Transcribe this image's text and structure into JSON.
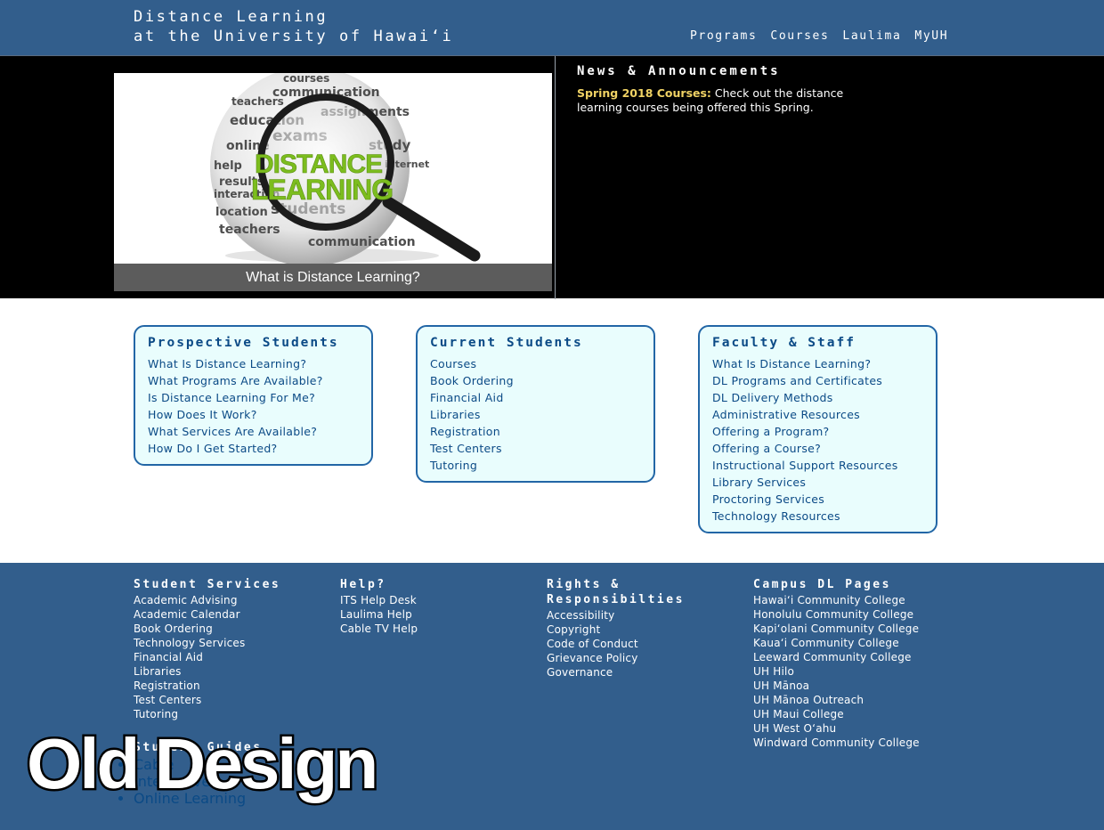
{
  "header": {
    "title_line1": "Distance Learning",
    "title_line2": "at the University of Hawaiʻi",
    "nav": [
      "Programs",
      "Courses",
      "Laulima",
      "MyUH"
    ],
    "bg_color": "#325e8c"
  },
  "hero": {
    "image_caption": "What is Distance Learning?",
    "image_words": {
      "center_line1": "DISTANCE",
      "center_line2": "LEARNING",
      "ring": [
        "courses",
        "communication",
        "teachers",
        "assignments",
        "education",
        "online",
        "exams",
        "study",
        "help",
        "results",
        "students",
        "location",
        "interaction",
        "internet",
        "teachers",
        "communication"
      ]
    },
    "news_title": "News & Announcements",
    "news_highlight": "Spring 2018 Courses:",
    "news_text": " Check out the distance learning courses being offered this Spring."
  },
  "panels": {
    "prospective": {
      "title": "Prospective Students",
      "links": [
        "What Is Distance Learning?",
        "What Programs Are Available?",
        "Is Distance Learning For Me?",
        "How Does It Work?",
        "What Services Are Available?",
        "How Do I Get Started?"
      ]
    },
    "current": {
      "title": "Current Students",
      "links": [
        "Courses",
        "Book Ordering",
        "Financial Aid",
        "Libraries",
        "Registration",
        "Test Centers",
        "Tutoring"
      ]
    },
    "faculty": {
      "title": "Faculty & Staff",
      "links": [
        "What Is Distance Learning?",
        "DL Programs and Certificates",
        "DL Delivery Methods",
        "Administrative Resources",
        "Offering a Program?",
        "Offering a Course?",
        "Instructional Support Resources",
        "Library Services",
        "Proctoring Services",
        "Technology Resources"
      ]
    }
  },
  "footer": {
    "student_services": {
      "title": "Student Services",
      "links": [
        "Academic Advising",
        "Academic Calendar",
        "Book Ordering",
        "Technology Services",
        "Financial Aid",
        "Libraries",
        "Registration",
        "Test Centers",
        "Tutoring"
      ]
    },
    "help": {
      "title": "Help?",
      "links": [
        "ITS Help Desk",
        "Laulima Help",
        "Cable TV Help"
      ]
    },
    "rights": {
      "title_line1": "Rights &",
      "title_line2": "Responsibilties",
      "links": [
        "Accessibility",
        "Copyright",
        "Code of Conduct",
        "Grievance Policy",
        "Governance"
      ]
    },
    "campus": {
      "title": "Campus DL Pages",
      "links": [
        "Hawaiʻi Community College",
        "Honolulu Community College",
        "Kapiʻolani Community College",
        "Kauaʻi Community College",
        "Leeward Community College",
        "UH Hilo",
        "UH Mānoa",
        "UH Mānoa Outreach",
        "UH Maui College",
        "UH West Oʻahu",
        "Windward Community College"
      ]
    },
    "student_guides": {
      "title": "Student Guides",
      "links": [
        "Cable",
        "Interactive",
        "Online Learning"
      ]
    }
  },
  "overlay_label": "Old Design"
}
